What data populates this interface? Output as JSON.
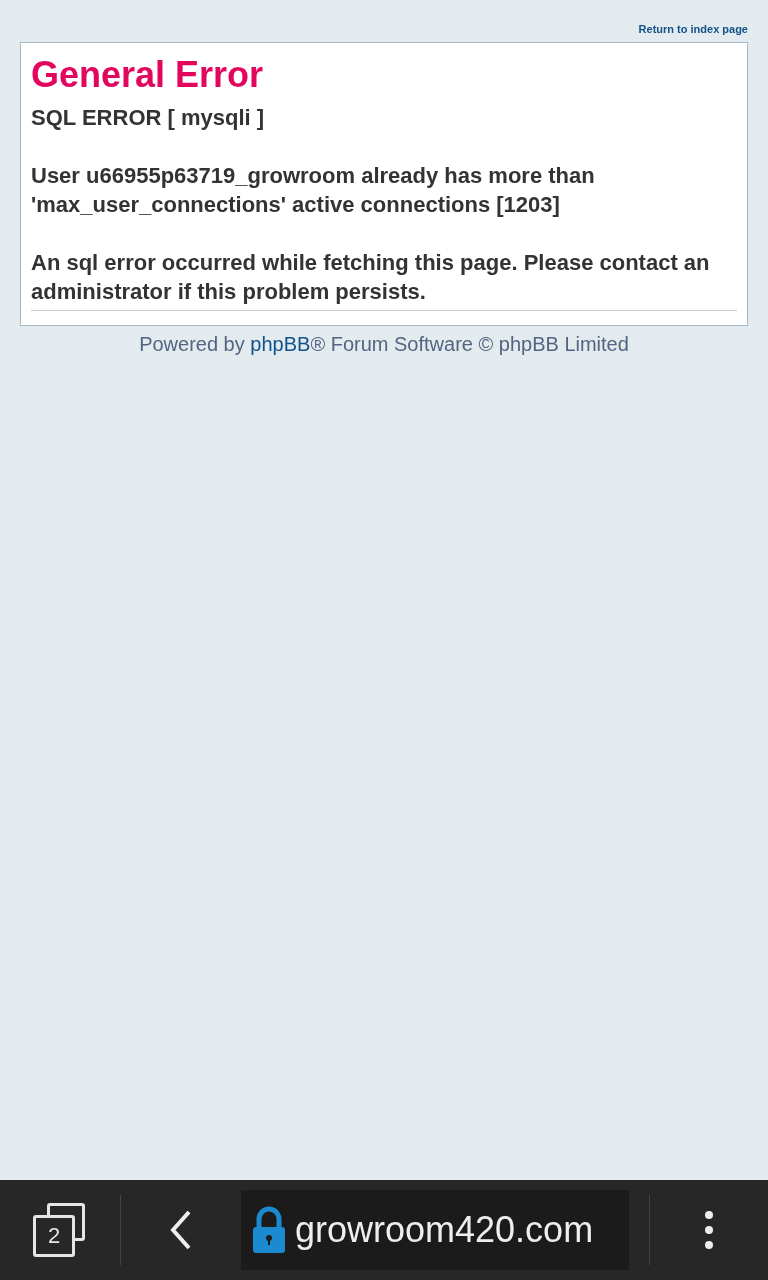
{
  "header": {
    "index_link": "Return to index page"
  },
  "error": {
    "title": "General Error",
    "subtitle": "SQL ERROR [ mysqli ]",
    "paragraphs": [
      "User u66955p63719_growroom already has more than 'max_user_connections' active connections [1203]",
      "An sql error occurred while fetching this page. Please contact an administrator if this problem persists."
    ]
  },
  "footer": {
    "before": "Powered by",
    "link": "phpBB",
    "after": "® Forum Software © phpBB Limited"
  },
  "browser_bar": {
    "tab_count": "2",
    "url": "growroom420.com",
    "secure": true
  }
}
